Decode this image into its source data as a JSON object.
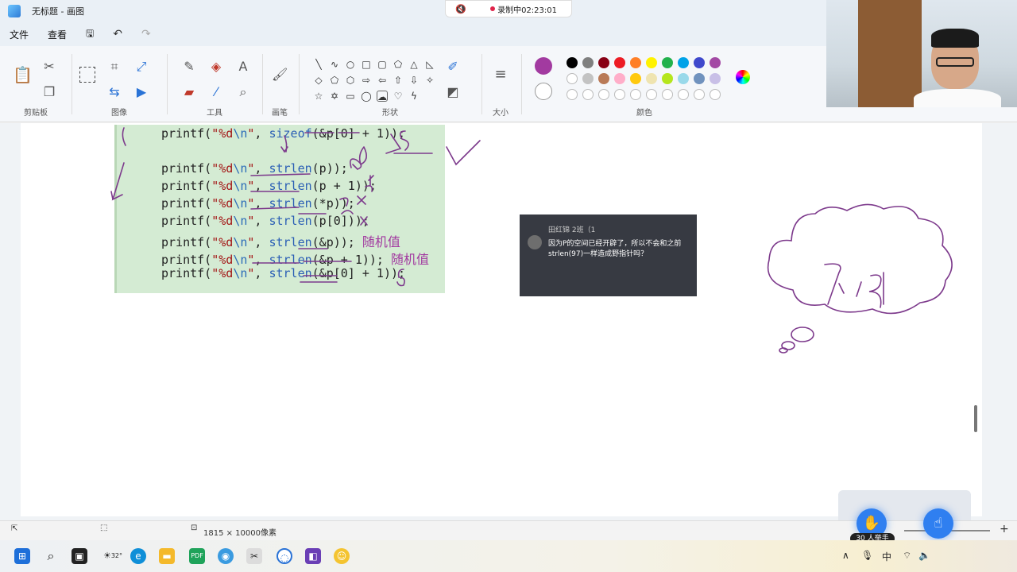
{
  "window": {
    "title": "无标题 - 画图"
  },
  "recording": {
    "label": "录制中02:23:01"
  },
  "menu": {
    "file": "文件",
    "view": "查看"
  },
  "ribbon": {
    "groups": {
      "clipboard": "剪贴板",
      "image": "图像",
      "tools": "工具",
      "brushes": "画笔",
      "shapes": "形状",
      "size": "大小",
      "colors": "颜色"
    },
    "primary_color": "#a23aa0",
    "secondary_color": "#ffffff",
    "palette_row1": [
      "#000000",
      "#7f7f7f",
      "#880015",
      "#ed1c24",
      "#ff7f27",
      "#fff200",
      "#22b14c",
      "#00a2e8",
      "#3f48cc",
      "#a349a4"
    ],
    "palette_row2": [
      "#ffffff",
      "#c3c3c3",
      "#b97a57",
      "#ffaec9",
      "#ffc90e",
      "#efe4b0",
      "#b5e61d",
      "#99d9ea",
      "#7092be",
      "#c8bfe7"
    ]
  },
  "code": {
    "lines": [
      {
        "prefix": "printf(",
        "fmt": "\"%d",
        "esc": "\\n",
        "fmt_end": "\"",
        "func": "sizeof",
        "args": "(&p[0] + 1));",
        "note": ""
      },
      {
        "prefix": "printf(",
        "fmt": "\"%d",
        "esc": "\\n",
        "fmt_end": "\"",
        "func": "strlen",
        "args": "(p));",
        "note": ""
      },
      {
        "prefix": "printf(",
        "fmt": "\"%d",
        "esc": "\\n",
        "fmt_end": "\"",
        "func": "strlen",
        "args": "(p + 1));",
        "note": ""
      },
      {
        "prefix": "printf(",
        "fmt": "\"%d",
        "esc": "\\n",
        "fmt_end": "\"",
        "func": "strlen",
        "args": "(*p));",
        "note": ""
      },
      {
        "prefix": "printf(",
        "fmt": "\"%d",
        "esc": "\\n",
        "fmt_end": "\"",
        "func": "strlen",
        "args": "(p[0]));",
        "note": ""
      },
      {
        "prefix": "printf(",
        "fmt": "\"%d",
        "esc": "\\n",
        "fmt_end": "\"",
        "func": "strlen",
        "args": "(&p));",
        "note": "随机值"
      },
      {
        "prefix": "printf(",
        "fmt": "\"%d",
        "esc": "\\n",
        "fmt_end": "\"",
        "func": "strlen",
        "args": "(&p + 1));",
        "note": "随机值"
      },
      {
        "prefix": "printf(",
        "fmt": "\"%d",
        "esc": "\\n",
        "fmt_end": "\"",
        "func": "strlen",
        "args": "(&p[0] + 1));",
        "note": ""
      }
    ]
  },
  "chat": {
    "user": "田红锦 2班（1",
    "message": "因为P的空间已经开辟了，所以不会和之前strlen(97)一样造成野指针吗？"
  },
  "status": {
    "canvas_size": "1815 × 10000像素"
  },
  "raise_hand": {
    "count": "30 人举手"
  },
  "taskbar": {
    "weather": "32°",
    "ime": "中"
  }
}
